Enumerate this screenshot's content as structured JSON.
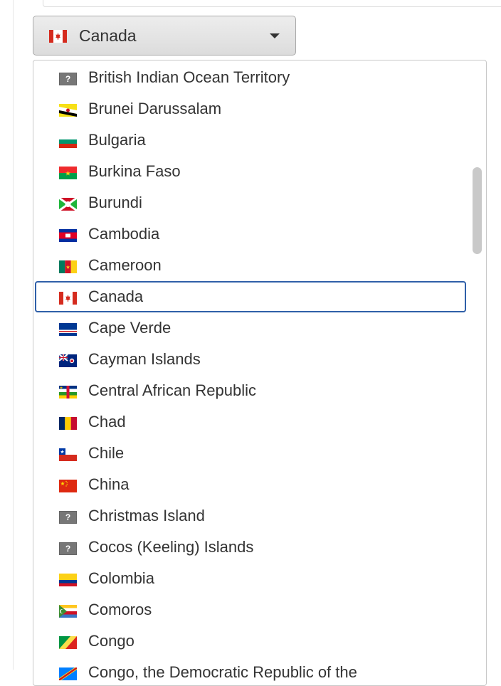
{
  "select": {
    "selected_label": "Canada",
    "selected_flag": "canada-flag-icon"
  },
  "countries": [
    {
      "label": "British Indian Ocean Territory",
      "flag": "unknown-flag-icon",
      "selected": false
    },
    {
      "label": "Brunei Darussalam",
      "flag": "brunei-flag-icon",
      "selected": false
    },
    {
      "label": "Bulgaria",
      "flag": "bulgaria-flag-icon",
      "selected": false
    },
    {
      "label": "Burkina Faso",
      "flag": "burkina-faso-flag-icon",
      "selected": false
    },
    {
      "label": "Burundi",
      "flag": "burundi-flag-icon",
      "selected": false
    },
    {
      "label": "Cambodia",
      "flag": "cambodia-flag-icon",
      "selected": false
    },
    {
      "label": "Cameroon",
      "flag": "cameroon-flag-icon",
      "selected": false
    },
    {
      "label": "Canada",
      "flag": "canada-flag-icon",
      "selected": true
    },
    {
      "label": "Cape Verde",
      "flag": "cape-verde-flag-icon",
      "selected": false
    },
    {
      "label": "Cayman Islands",
      "flag": "cayman-islands-flag-icon",
      "selected": false
    },
    {
      "label": "Central African Republic",
      "flag": "central-african-republic-flag-icon",
      "selected": false
    },
    {
      "label": "Chad",
      "flag": "chad-flag-icon",
      "selected": false
    },
    {
      "label": "Chile",
      "flag": "chile-flag-icon",
      "selected": false
    },
    {
      "label": "China",
      "flag": "china-flag-icon",
      "selected": false
    },
    {
      "label": "Christmas Island",
      "flag": "unknown-flag-icon",
      "selected": false
    },
    {
      "label": "Cocos (Keeling) Islands",
      "flag": "unknown-flag-icon",
      "selected": false
    },
    {
      "label": "Colombia",
      "flag": "colombia-flag-icon",
      "selected": false
    },
    {
      "label": "Comoros",
      "flag": "comoros-flag-icon",
      "selected": false
    },
    {
      "label": "Congo",
      "flag": "congo-flag-icon",
      "selected": false
    },
    {
      "label": "Congo, the Democratic Republic of the",
      "flag": "congo-drc-flag-icon",
      "selected": false
    }
  ],
  "unknown_flag_glyph": "?",
  "colors": {
    "selected_border": "#2f5fa8",
    "scrollbar_thumb": "#c9c9c9"
  }
}
